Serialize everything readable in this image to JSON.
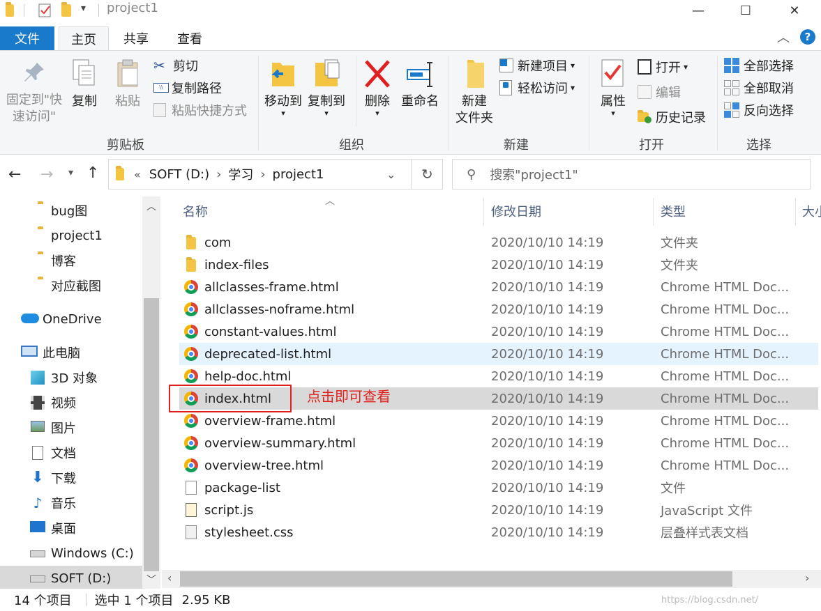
{
  "window": {
    "title": "project1",
    "minimize": "—",
    "maximize": "☐",
    "close": "✕"
  },
  "ribbon_tabs": [
    "文件",
    "主页",
    "共享",
    "查看"
  ],
  "ribbon": {
    "clipboard": {
      "label": "剪贴板",
      "pin": "固定到\"快\n速访问\"",
      "copy": "复制",
      "paste": "粘贴",
      "cut": "剪切",
      "copy_path": "复制路径",
      "paste_shortcut": "粘贴快捷方式"
    },
    "organize": {
      "label": "组织",
      "move_to": "移动到",
      "copy_to": "复制到",
      "delete": "删除",
      "rename": "重命名"
    },
    "new": {
      "label": "新建",
      "new_folder": "新建\n文件夹",
      "new_item": "新建项目",
      "easy_access": "轻松访问"
    },
    "open": {
      "label": "打开",
      "properties": "属性",
      "open": "打开",
      "edit": "编辑",
      "history": "历史记录"
    },
    "select": {
      "label": "选择",
      "select_all": "全部选择",
      "select_none": "全部取消",
      "invert": "反向选择"
    }
  },
  "address": {
    "prefix": "«",
    "segments": [
      "SOFT (D:)",
      "学习",
      "project1"
    ],
    "search_placeholder": "搜索\"project1\""
  },
  "nav_pane": [
    {
      "label": "bug图",
      "icon": "folder-icon"
    },
    {
      "label": "project1",
      "icon": "folder-icon"
    },
    {
      "label": "博客",
      "icon": "folder-icon"
    },
    {
      "label": "对应截图",
      "icon": "folder-icon"
    },
    {
      "label": "OneDrive",
      "icon": "cloud-icon"
    },
    {
      "label": "此电脑",
      "icon": "pc-icon"
    },
    {
      "label": "3D 对象",
      "icon": "cube-icon"
    },
    {
      "label": "视频",
      "icon": "video-icon"
    },
    {
      "label": "图片",
      "icon": "picture-icon"
    },
    {
      "label": "文档",
      "icon": "document-icon"
    },
    {
      "label": "下载",
      "icon": "download-icon"
    },
    {
      "label": "音乐",
      "icon": "music-icon"
    },
    {
      "label": "桌面",
      "icon": "desktop-icon"
    },
    {
      "label": "Windows (C:)",
      "icon": "drive-icon"
    },
    {
      "label": "SOFT (D:)",
      "icon": "drive-icon"
    }
  ],
  "columns": {
    "name": "名称",
    "date": "修改日期",
    "type": "类型",
    "size": "大小"
  },
  "files": [
    {
      "name": "com",
      "date": "2020/10/10 14:19",
      "type": "文件夹",
      "icon": "folder"
    },
    {
      "name": "index-files",
      "date": "2020/10/10 14:19",
      "type": "文件夹",
      "icon": "folder"
    },
    {
      "name": "allclasses-frame.html",
      "date": "2020/10/10 14:19",
      "type": "Chrome HTML Doc...",
      "icon": "chrome"
    },
    {
      "name": "allclasses-noframe.html",
      "date": "2020/10/10 14:19",
      "type": "Chrome HTML Doc...",
      "icon": "chrome"
    },
    {
      "name": "constant-values.html",
      "date": "2020/10/10 14:19",
      "type": "Chrome HTML Doc...",
      "icon": "chrome"
    },
    {
      "name": "deprecated-list.html",
      "date": "2020/10/10 14:19",
      "type": "Chrome HTML Doc...",
      "icon": "chrome"
    },
    {
      "name": "help-doc.html",
      "date": "2020/10/10 14:19",
      "type": "Chrome HTML Doc...",
      "icon": "chrome"
    },
    {
      "name": "index.html",
      "date": "2020/10/10 14:19",
      "type": "Chrome HTML Doc...",
      "icon": "chrome"
    },
    {
      "name": "overview-frame.html",
      "date": "2020/10/10 14:19",
      "type": "Chrome HTML Doc...",
      "icon": "chrome"
    },
    {
      "name": "overview-summary.html",
      "date": "2020/10/10 14:19",
      "type": "Chrome HTML Doc...",
      "icon": "chrome"
    },
    {
      "name": "overview-tree.html",
      "date": "2020/10/10 14:19",
      "type": "Chrome HTML Doc...",
      "icon": "chrome"
    },
    {
      "name": "package-list",
      "date": "2020/10/10 14:19",
      "type": "文件",
      "icon": "file"
    },
    {
      "name": "script.js",
      "date": "2020/10/10 14:19",
      "type": "JavaScript 文件",
      "icon": "script"
    },
    {
      "name": "stylesheet.css",
      "date": "2020/10/10 14:19",
      "type": "层叠样式表文档",
      "icon": "css"
    }
  ],
  "annotation": "点击即可查看",
  "status": {
    "count": "14 个项目",
    "selected": "选中 1 个项目",
    "size": "2.95 KB"
  },
  "watermark": "https://blog.csdn.net/",
  "colors": {
    "accent": "#1979ca",
    "selected_row": "#cce8ff",
    "hover_row": "#e5f3ff",
    "annotation_red": "#e0201b"
  }
}
